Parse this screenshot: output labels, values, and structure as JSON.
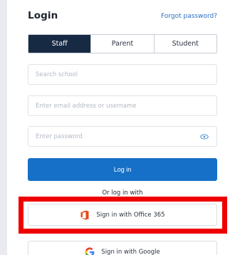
{
  "login": {
    "title": "Login",
    "forgot_password": "Forgot password?"
  },
  "tabs": [
    {
      "label": "Staff",
      "active": true
    },
    {
      "label": "Parent",
      "active": false
    },
    {
      "label": "Student",
      "active": false
    }
  ],
  "fields": {
    "school_placeholder": "Search school",
    "email_placeholder": "Enter email address or username",
    "password_placeholder": "Enter password"
  },
  "actions": {
    "login_label": "Log in",
    "or_text": "Or log in with",
    "office_label": "Sign in with Office 365",
    "google_label": "Sign in with Google"
  },
  "colors": {
    "active_tab": "#172a44",
    "primary": "#1670c7",
    "link": "#2a6fc4",
    "highlight": "#ee0000",
    "office": "#e64a19"
  },
  "icons": {
    "password_toggle": "eye-icon",
    "office": "office-365-icon",
    "google": "google-icon"
  }
}
